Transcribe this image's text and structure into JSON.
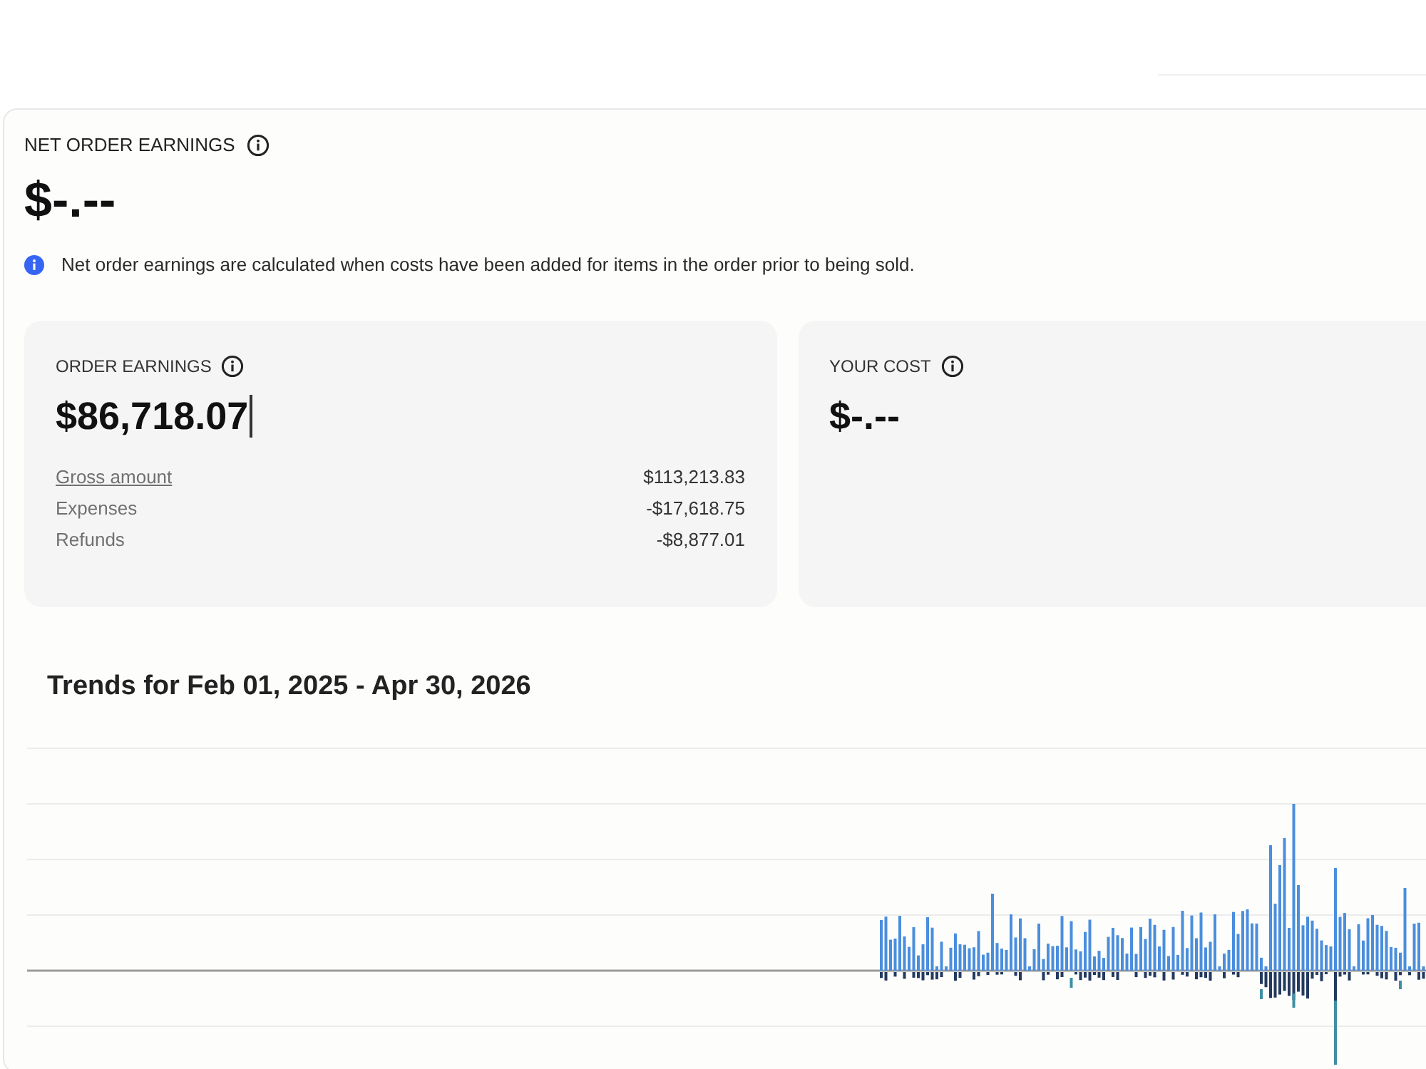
{
  "summary": {
    "title": "NET ORDER EARNINGS",
    "amount": "$-.--",
    "notice": "Net order earnings are calculated when costs have been added for items in the order prior to being sold."
  },
  "cards": [
    {
      "title": "ORDER EARNINGS",
      "amount": "$86,718.07",
      "caret": true,
      "lines": [
        {
          "label": "Gross amount",
          "value": "$113,213.83",
          "kind": "link"
        },
        {
          "label": "Expenses",
          "value": "-$17,618.75",
          "kind": "plain"
        },
        {
          "label": "Refunds",
          "value": "-$8,877.01",
          "kind": "plain"
        }
      ]
    },
    {
      "title": "YOUR COST",
      "amount": "$-.--",
      "caret": false
    }
  ],
  "trends": {
    "title": "Trends for Feb 01, 2025 - Apr 30, 2026"
  }
}
